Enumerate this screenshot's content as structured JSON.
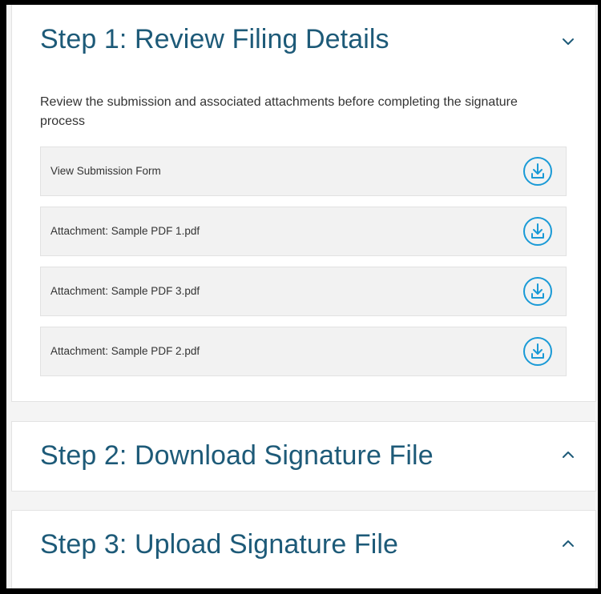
{
  "steps": [
    {
      "title": "Step 1: Review Filing Details",
      "toggle_icon": "chevron-down-icon",
      "expanded": true,
      "intro": "Review the submission and associated attachments before completing the signature process",
      "files": [
        {
          "label": "View Submission Form",
          "icon": "download-icon"
        },
        {
          "label": "Attachment: Sample PDF 1.pdf",
          "icon": "download-icon"
        },
        {
          "label": "Attachment: Sample PDF 3.pdf",
          "icon": "download-icon"
        },
        {
          "label": "Attachment: Sample PDF 2.pdf",
          "icon": "download-icon"
        }
      ]
    },
    {
      "title": "Step 2: Download Signature File",
      "toggle_icon": "chevron-up-icon",
      "expanded": false
    },
    {
      "title": "Step 3: Upload Signature File",
      "toggle_icon": "chevron-up-icon",
      "expanded": false
    }
  ],
  "colors": {
    "heading": "#1d5a78",
    "accent": "#1a9ad6",
    "row_background": "#f2f2f2",
    "page_background": "#f4f4f4",
    "outer_border": "#000000"
  }
}
